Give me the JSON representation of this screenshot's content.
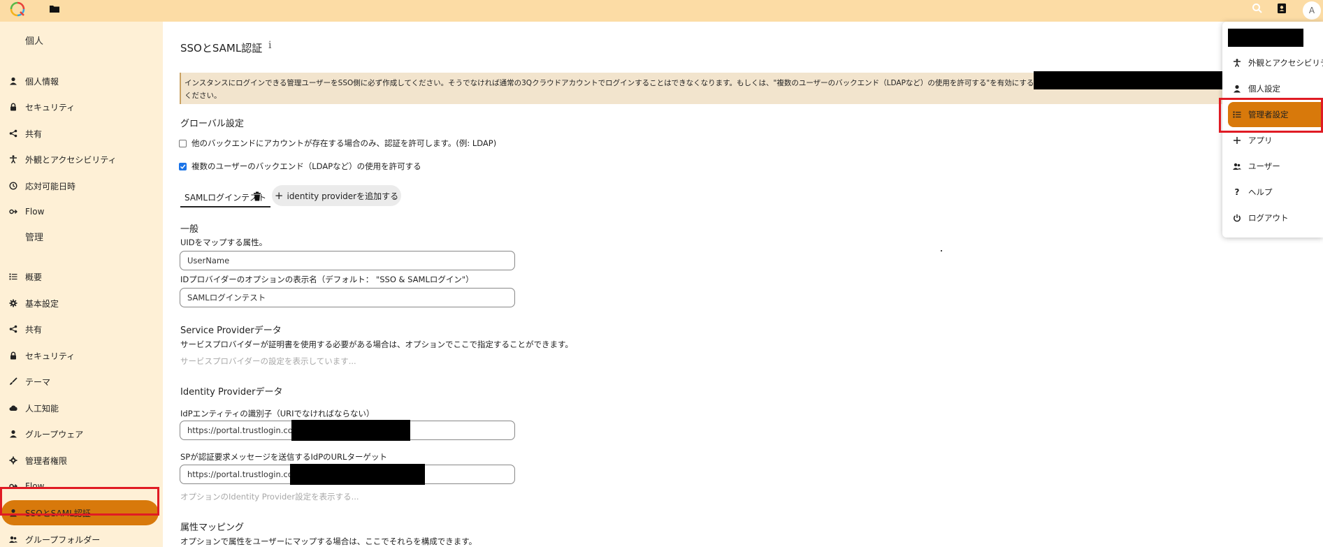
{
  "topbar": {
    "avatar_letter": "A"
  },
  "sidebar": {
    "personal_caption": "個人",
    "personal_items": [
      {
        "label": "個人情報"
      },
      {
        "label": "セキュリティ"
      },
      {
        "label": "共有"
      },
      {
        "label": "外観とアクセシビリティ"
      },
      {
        "label": "応対可能日時"
      },
      {
        "label": "Flow"
      }
    ],
    "admin_caption": "管理",
    "admin_items": [
      {
        "label": "概要"
      },
      {
        "label": "基本設定"
      },
      {
        "label": "共有"
      },
      {
        "label": "セキュリティ"
      },
      {
        "label": "テーマ"
      },
      {
        "label": "人工知能"
      },
      {
        "label": "グループウェア"
      },
      {
        "label": "管理者権限"
      },
      {
        "label": "Flow"
      },
      {
        "label": "SSOとSAML認証",
        "active": true
      },
      {
        "label": "グループフォルダー"
      }
    ]
  },
  "main": {
    "title": "SSOとSAML認証",
    "info_glyph": "i",
    "warning_line1": "インスタンスにログインできる管理ユーザーをSSO側に必ず作成してください。そうでなければ通常の3Qクラウドアカウントでログインすることはできなくなります。もしくは、\"複数のユーザーのバックエンド（LDAPなど）の使用を許可する\"を有効にするか、直接URL https://",
    "warning_line2": "ください。",
    "global_settings_heading": "グローバル設定",
    "checkbox_allow_other_backend": {
      "label": "他のバックエンドにアカウントが存在する場合のみ、認証を許可します。(例: LDAP)",
      "checked": false
    },
    "checkbox_multiple_backends": {
      "label": "複数のユーザーのバックエンド（LDAPなど）の使用を許可する",
      "checked": true
    },
    "provider_tab_label": "SAMLログインテスト",
    "add_provider_label": "identity providerを追加する",
    "general_heading": "一般",
    "uid_label": "UIDをマップする属性。",
    "uid_value": "UserName",
    "display_name_label": "IDプロバイダーのオプションの表示名（デフォルト： \"SSO & SAMLログイン\"）",
    "display_name_value": "SAMLログインテスト",
    "sp_heading": "Service Providerデータ",
    "sp_description": "サービスプロバイダーが証明書を使用する必要がある場合は、オプションでここで指定することができます。",
    "sp_show_link": "サービスプロバイダーの設定を表示しています...",
    "idp_heading": "Identity Providerデータ",
    "idp_entity_label": "IdPエンティティの識別子（URIでなければならない）",
    "idp_entity_value": "https://portal.trustlogin.com",
    "idp_sso_label": "SPが認証要求メッセージを送信するIdPのURLターゲット",
    "idp_sso_value": "https://portal.trustlogin.com",
    "idp_show_link": "オプションのIdentity Provider設定を表示する...",
    "attr_heading": "属性マッピング",
    "attr_description": "オプションで属性をユーザーにマップする場合は、ここでそれらを構成できます。"
  },
  "user_menu": {
    "items": [
      {
        "label": "外観とアクセシビリティ"
      },
      {
        "label": "個人設定"
      },
      {
        "label": "管理者設定",
        "active": true
      },
      {
        "label": "アプリ"
      },
      {
        "label": "ユーザー"
      },
      {
        "label": "ヘルプ"
      },
      {
        "label": "ログアウト"
      }
    ]
  },
  "colors": {
    "topbar": "#fcdca5",
    "sidebar": "#fef0d6",
    "accent": "#d8790b",
    "warning_bg": "#f2e4cd",
    "highlight": "#e01b24"
  }
}
